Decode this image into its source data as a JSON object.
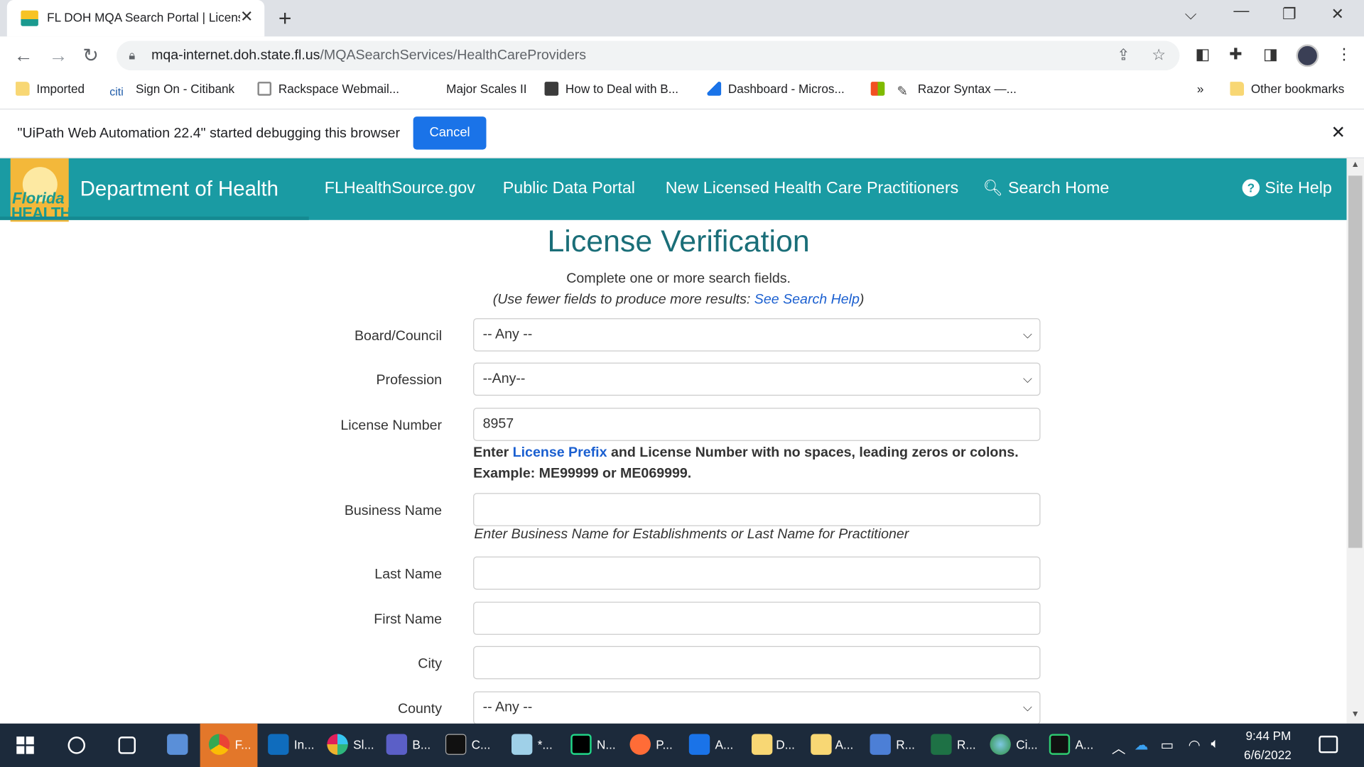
{
  "tab": {
    "title": "FL DOH MQA Search Portal | License Verification"
  },
  "address": {
    "host": "mqa-internet.doh.state.fl.us",
    "path": "/MQASearchServices/HealthCareProviders"
  },
  "bookmarks": {
    "items": [
      {
        "label": "Imported",
        "icon": "folder-icon"
      },
      {
        "label": "Sign On - Citibank",
        "icon": "citi-icon"
      },
      {
        "label": "Rackspace Webmail...",
        "icon": "mail-icon"
      },
      {
        "label": "Major Scales II",
        "icon": ""
      },
      {
        "label": "How to Deal with B...",
        "icon": "book-icon"
      },
      {
        "label": "Dashboard - Micros...",
        "icon": "azure-icon"
      },
      {
        "label": "Razor Syntax —...",
        "icon": "pencil-icon"
      }
    ],
    "overflow": "»",
    "other": "Other bookmarks"
  },
  "infobar": {
    "message": "\"UiPath Web Automation 22.4\" started debugging this browser",
    "cancel": "Cancel"
  },
  "header": {
    "logo_line1": "Florida",
    "logo_line2": "HEALTH",
    "dept": "Department of Health",
    "nav": {
      "flhealthsource": "FLHealthSource.gov",
      "public_data": "Public Data Portal",
      "new_licensed": "New Licensed Health Care Practitioners",
      "search_home": "Search Home",
      "site_help": "Site Help"
    }
  },
  "form": {
    "title": "License Verification",
    "instruction": "Complete one or more search fields.",
    "hint_prefix": "(Use fewer fields to produce more results: ",
    "hint_link": "See Search Help",
    "hint_suffix": ")",
    "board_label": "Board/Council",
    "board_value": "-- Any --",
    "profession_label": "Profession",
    "profession_value": "--Any--",
    "license_label": "License Number",
    "license_value": "8957",
    "license_help_prefix": "Enter ",
    "license_help_link": "License Prefix",
    "license_help_suffix": " and License Number with no spaces, leading zeros or colons. Example: ME99999 or ME069999.",
    "business_label": "Business Name",
    "business_value": "",
    "business_help": "Enter Business Name for Establishments or Last Name for Practitioner",
    "last_label": "Last Name",
    "last_value": "",
    "first_label": "First Name",
    "first_value": "",
    "city_label": "City",
    "city_value": "",
    "county_label": "County",
    "county_value": "-- Any --"
  },
  "taskbar": {
    "apps": [
      {
        "label": "F...",
        "icon": "chrome-icon"
      },
      {
        "label": "In...",
        "icon": "outlook-icon"
      },
      {
        "label": "Sl...",
        "icon": "slack-icon"
      },
      {
        "label": "B...",
        "icon": "teams-icon"
      },
      {
        "label": "C...",
        "icon": "terminal-icon"
      },
      {
        "label": "*...",
        "icon": "notepad-icon"
      },
      {
        "label": "N...",
        "icon": "pycharm-icon"
      },
      {
        "label": "P...",
        "icon": "postman-icon"
      },
      {
        "label": "A...",
        "icon": "sharepoint-icon"
      },
      {
        "label": "D...",
        "icon": "folder-icon"
      },
      {
        "label": "A...",
        "icon": "folder-icon"
      },
      {
        "label": "R...",
        "icon": "remote-desktop-icon"
      },
      {
        "label": "R...",
        "icon": "excel-icon"
      },
      {
        "label": "Ci...",
        "icon": "globe-icon"
      },
      {
        "label": "A...",
        "icon": "uipath-assistant-icon"
      }
    ],
    "time": "9:44 PM",
    "date": "6/6/2022"
  },
  "colors": {
    "header_teal": "#1a9ba3",
    "title_teal": "#1a6e78",
    "link_blue": "#1a5fd0",
    "button_blue": "#1a73e8"
  }
}
